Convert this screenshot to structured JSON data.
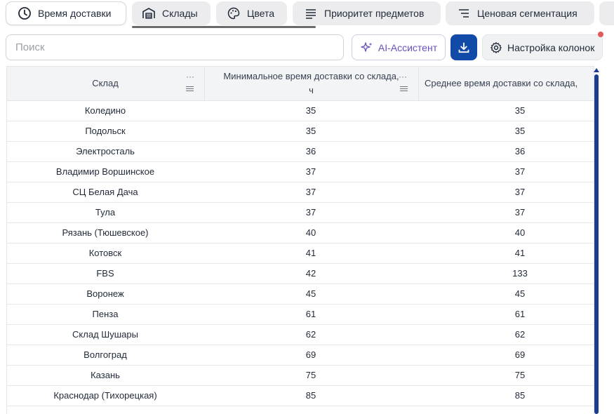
{
  "tabs": [
    {
      "label": "Время доставки",
      "icon": "clock-icon",
      "active": true
    },
    {
      "label": "Склады",
      "icon": "warehouse-icon",
      "active": false
    },
    {
      "label": "Цвета",
      "icon": "palette-icon",
      "active": false
    },
    {
      "label": "Приоритет предметов",
      "icon": "lines-icon",
      "active": false
    },
    {
      "label": "Ценовая сегментация",
      "icon": "sort-lines-icon",
      "active": false
    }
  ],
  "toolbar": {
    "search_placeholder": "Поиск",
    "ai_label": "AI-Ассистент",
    "download_icon": "download-icon",
    "columns_label": "Настройка колонок"
  },
  "colors": {
    "primary": "#124aa7",
    "ai_accent": "#6a4fc0",
    "scrollbar": "#1a3d8f",
    "notification": "#e25a5a"
  },
  "table": {
    "columns": [
      "Склад",
      "Минимальное время доставки со склада, ч",
      "Среднее время доставки со склада,"
    ],
    "rows": [
      [
        "Коледино",
        "35",
        "35"
      ],
      [
        "Подольск",
        "35",
        "35"
      ],
      [
        "Электросталь",
        "36",
        "36"
      ],
      [
        "Владимир Воршинское",
        "37",
        "37"
      ],
      [
        "СЦ Белая Дача",
        "37",
        "37"
      ],
      [
        "Тула",
        "37",
        "37"
      ],
      [
        "Рязань (Тюшевское)",
        "40",
        "40"
      ],
      [
        "Котовск",
        "41",
        "41"
      ],
      [
        "FBS",
        "42",
        "133"
      ],
      [
        "Воронеж",
        "45",
        "45"
      ],
      [
        "Пенза",
        "61",
        "61"
      ],
      [
        "Склад Шушары",
        "62",
        "62"
      ],
      [
        "Волгоград",
        "69",
        "69"
      ],
      [
        "Казань",
        "75",
        "75"
      ],
      [
        "Краснодар (Тихорецкая)",
        "85",
        "85"
      ]
    ]
  }
}
